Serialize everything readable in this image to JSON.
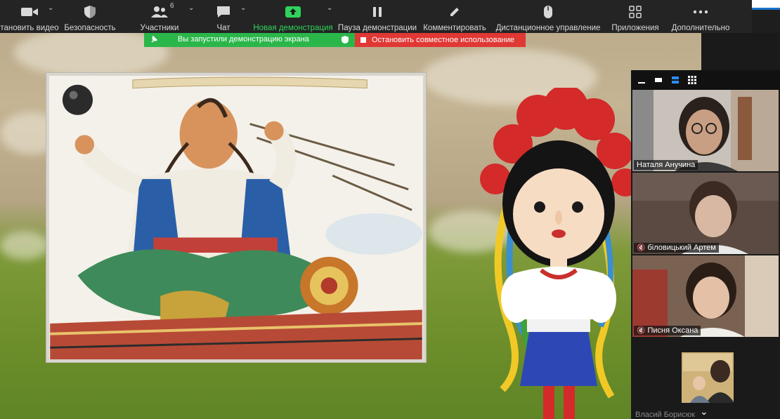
{
  "toolbar": {
    "items": [
      {
        "label": "тановить видео",
        "icon": "video-camera-icon",
        "caret": true
      },
      {
        "label": "Безопасность",
        "icon": "shield-icon"
      },
      {
        "label": "Участники",
        "icon": "participants-icon",
        "badge": "6",
        "caret": true
      },
      {
        "label": "Чат",
        "icon": "chat-icon",
        "caret": true
      },
      {
        "label": "Новая демонстрация",
        "icon": "share-screen-icon",
        "caret": true
      },
      {
        "label": "Пауза демонстрации",
        "icon": "pause-icon"
      },
      {
        "label": "Комментировать",
        "icon": "pencil-icon"
      },
      {
        "label": "Дистанционное управление",
        "icon": "mouse-icon"
      },
      {
        "label": "Приложения",
        "icon": "apps-icon"
      },
      {
        "label": "Дополнительно",
        "icon": "more-icon"
      }
    ]
  },
  "share_bar": {
    "status": "Вы запустили демонстрацию экрана",
    "stop": "Остановить совместное использование"
  },
  "panel": {
    "participants": [
      {
        "name": "Наталя Анучина",
        "muted": false
      },
      {
        "name": "біловицький Артем",
        "muted": true
      },
      {
        "name": "Писня Оксана",
        "muted": true
      },
      {
        "name": "Власий Борисюк",
        "muted": false
      }
    ]
  },
  "colors": {
    "toolbar_bg": "#242424",
    "share_green": "#2bb64a",
    "share_red": "#e03834",
    "panel_bg": "#1a1a1a"
  }
}
